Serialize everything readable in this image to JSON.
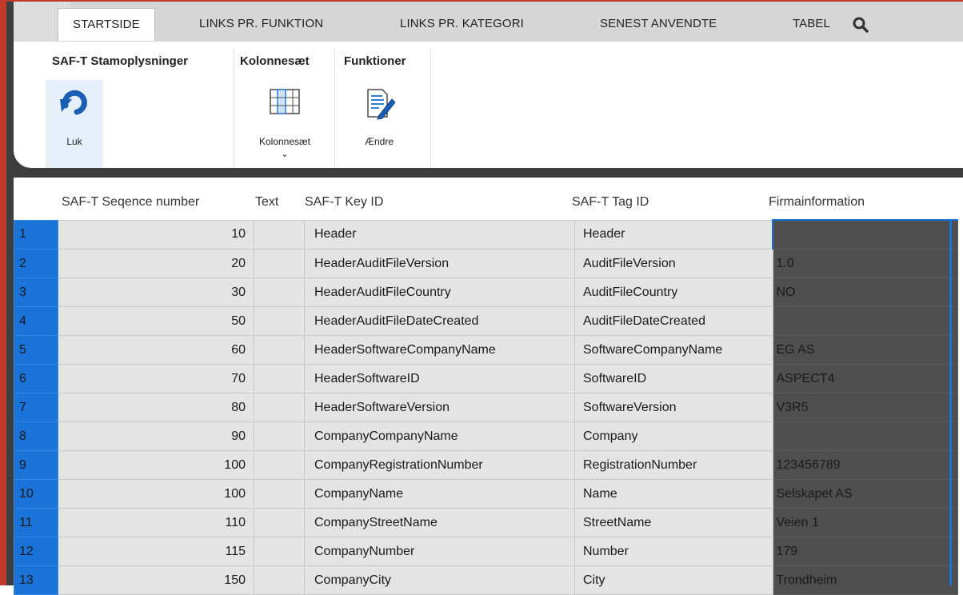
{
  "tabs": [
    {
      "label": "STARTSIDE",
      "active": true
    },
    {
      "label": "LINKS PR. FUNKTION",
      "active": false
    },
    {
      "label": "LINKS PR. KATEGORI",
      "active": false
    },
    {
      "label": "SENEST ANVENDTE",
      "active": false
    },
    {
      "label": "TABEL",
      "active": false
    }
  ],
  "search_icon": "search-icon",
  "ribbon": {
    "groups": [
      {
        "title": "SAF-T Stamoplysninger",
        "buttons": [
          {
            "label": "Luk",
            "icon": "undo-arrow-icon",
            "selected": true
          }
        ]
      },
      {
        "title": "Kolonnesæt",
        "buttons": [
          {
            "label": "Kolonnesæt",
            "icon": "column-set-icon",
            "dropdown": "⌄"
          }
        ]
      },
      {
        "title": "Funktioner",
        "buttons": [
          {
            "label": "Ændre",
            "icon": "edit-document-icon"
          }
        ]
      }
    ]
  },
  "grid": {
    "columns": [
      "SAF-T Seqence number",
      "Text",
      "SAF-T Key ID",
      "SAF-T Tag ID",
      "Firmainformation"
    ],
    "rows": [
      {
        "n": "1",
        "seq": "10",
        "text": "",
        "key": "Header",
        "tag": "Header",
        "firm": ""
      },
      {
        "n": "2",
        "seq": "20",
        "text": "",
        "key": "HeaderAuditFileVersion",
        "tag": "AuditFileVersion",
        "firm": "1.0"
      },
      {
        "n": "3",
        "seq": "30",
        "text": "",
        "key": "HeaderAuditFileCountry",
        "tag": "AuditFileCountry",
        "firm": "NO"
      },
      {
        "n": "4",
        "seq": "50",
        "text": "",
        "key": "HeaderAuditFileDateCreated",
        "tag": "AuditFileDateCreated",
        "firm": ""
      },
      {
        "n": "5",
        "seq": "60",
        "text": "",
        "key": "HeaderSoftwareCompanyName",
        "tag": "SoftwareCompanyName",
        "firm": "EG AS"
      },
      {
        "n": "6",
        "seq": "70",
        "text": "",
        "key": "HeaderSoftwareID",
        "tag": "SoftwareID",
        "firm": "ASPECT4"
      },
      {
        "n": "7",
        "seq": "80",
        "text": "",
        "key": "HeaderSoftwareVersion",
        "tag": "SoftwareVersion",
        "firm": "V3R5"
      },
      {
        "n": "8",
        "seq": "90",
        "text": "",
        "key": "CompanyCompanyName",
        "tag": "Company",
        "firm": ""
      },
      {
        "n": "9",
        "seq": "100",
        "text": "",
        "key": "CompanyRegistrationNumber",
        "tag": "RegistrationNumber",
        "firm": "123456789"
      },
      {
        "n": "10",
        "seq": "100",
        "text": "",
        "key": "CompanyName",
        "tag": "Name",
        "firm": "Selskapet AS"
      },
      {
        "n": "11",
        "seq": "110",
        "text": "",
        "key": "CompanyStreetName",
        "tag": "StreetName",
        "firm": "Veien 1"
      },
      {
        "n": "12",
        "seq": "115",
        "text": "",
        "key": "CompanyNumber",
        "tag": "Number",
        "firm": "179"
      },
      {
        "n": "13",
        "seq": "150",
        "text": "",
        "key": "CompanyCity",
        "tag": "City",
        "firm": "Trondheim"
      }
    ]
  },
  "colors": {
    "accent_blue": "#1a73d9",
    "frame_red": "#c0392b",
    "firm_column_bg": "#4f4f4f",
    "cell_bg": "#e4e4e4"
  }
}
